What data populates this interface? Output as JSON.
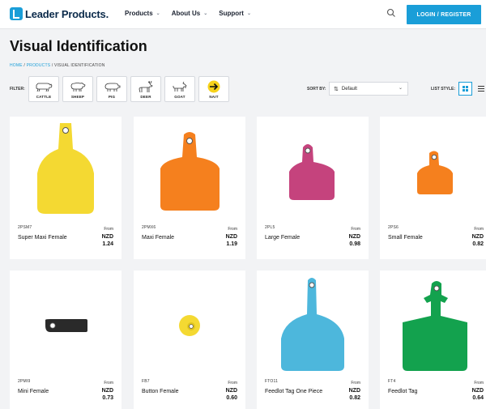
{
  "header": {
    "logo_text": "Leader Products.",
    "nav": [
      "Products",
      "About Us",
      "Support"
    ],
    "login_label": "LOGIN / REGISTER"
  },
  "page": {
    "title": "Visual Identification",
    "breadcrumb": {
      "home": "HOME",
      "products": "PRODUCTS",
      "current": "VISUAL IDENTIFICATION"
    }
  },
  "filter": {
    "label": "FILTER:",
    "items": [
      {
        "label": "CATTLE",
        "icon": "cattle-icon"
      },
      {
        "label": "SHEEP",
        "icon": "sheep-icon"
      },
      {
        "label": "PIG",
        "icon": "pig-icon"
      },
      {
        "label": "DEER",
        "icon": "deer-icon"
      },
      {
        "label": "GOAT",
        "icon": "goat-icon"
      },
      {
        "label": "NAIT",
        "icon": "nait-arrow-icon"
      }
    ]
  },
  "sort": {
    "label": "SORT BY:",
    "value": "Default"
  },
  "list_style": {
    "label": "LIST STYLE:"
  },
  "colors": {
    "accent": "#1a9ed8",
    "yellow": "#f4d932",
    "orange": "#f5801e",
    "magenta": "#c5437d",
    "blue": "#4db7dc",
    "green": "#13a24e",
    "black": "#2a2a2a"
  },
  "products": [
    {
      "sku": "2PSM7",
      "name": "Super Maxi Female",
      "from": "From",
      "currency": "NZD",
      "price": "1.24",
      "color": "yellow"
    },
    {
      "sku": "2PMX6",
      "name": "Maxi Female",
      "from": "From",
      "currency": "NZD",
      "price": "1.19",
      "color": "orange"
    },
    {
      "sku": "2PL5",
      "name": "Large Female",
      "from": "From",
      "currency": "NZD",
      "price": "0.98",
      "color": "magenta"
    },
    {
      "sku": "2PS6",
      "name": "Small Female",
      "from": "From",
      "currency": "NZD",
      "price": "0.82",
      "color": "orange"
    },
    {
      "sku": "2PMI9",
      "name": "Mini Female",
      "from": "From",
      "currency": "NZD",
      "price": "0.73",
      "color": "black"
    },
    {
      "sku": "FB7",
      "name": "Button Female",
      "from": "From",
      "currency": "NZD",
      "price": "0.60",
      "color": "yellow"
    },
    {
      "sku": "FTO11",
      "name": "Feedlot Tag One Piece",
      "from": "From",
      "currency": "NZD",
      "price": "0.82",
      "color": "blue"
    },
    {
      "sku": "FT4",
      "name": "Feedlot Tag",
      "from": "From",
      "currency": "NZD",
      "price": "0.64",
      "color": "green"
    }
  ]
}
